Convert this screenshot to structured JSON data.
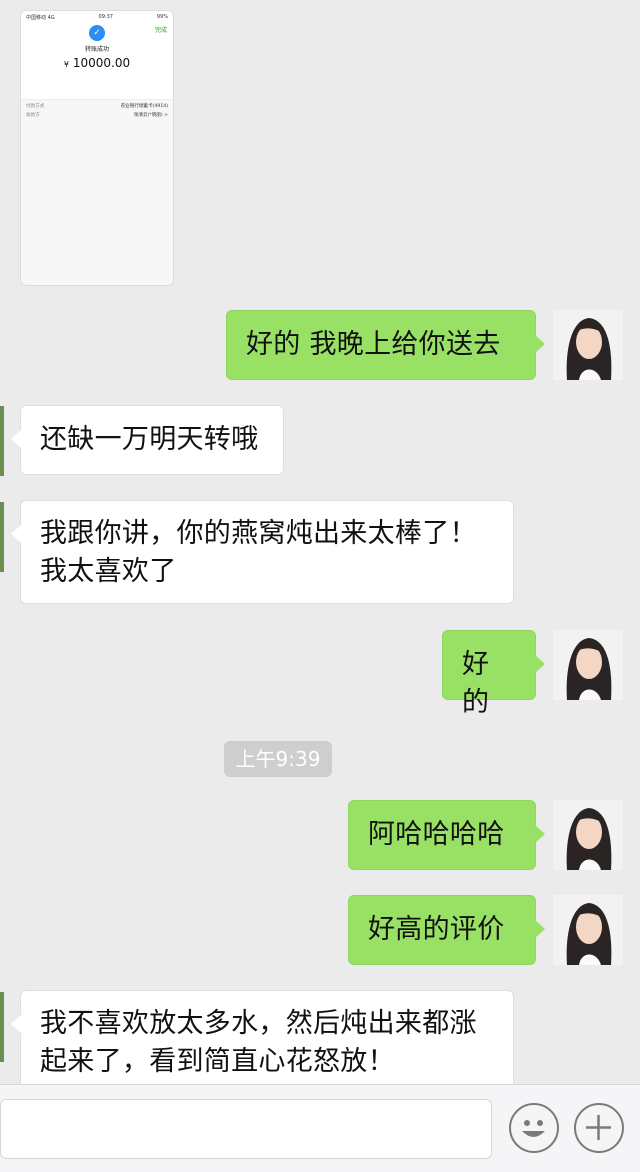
{
  "transfer_card": {
    "status_left": "中国移动  4G",
    "status_time": "09:37",
    "status_right": "99%",
    "done_label": "完成",
    "title": "转账成功",
    "currency": "¥",
    "amount": "10000.00",
    "rows": [
      {
        "label": "付款方式",
        "value": "农业银行储蓄卡(4914)"
      },
      {
        "label": "收款方",
        "value": "张清云(*晓丽) >"
      }
    ]
  },
  "messages": [
    {
      "side": "out",
      "text": "好的 我晚上给你送去"
    },
    {
      "side": "in",
      "text": "还缺一万明天转哦"
    },
    {
      "side": "in",
      "lines": [
        "我跟你讲，你的燕窝炖出来太棒了！",
        "我太喜欢了"
      ]
    },
    {
      "side": "out",
      "text": "好的"
    },
    {
      "side": "out",
      "text": "阿哈哈哈哈"
    },
    {
      "side": "out",
      "text": "好高的评价"
    },
    {
      "side": "in",
      "lines": [
        "我不喜欢放太多水，然后炖出来都涨",
        "起来了，看到简直心花怒放！"
      ]
    }
  ],
  "timestamp": "上午9:39",
  "input": {
    "value": "",
    "placeholder": ""
  },
  "icons": {
    "emoji": "emoji-face-icon",
    "plus": "plus-circle-icon"
  }
}
